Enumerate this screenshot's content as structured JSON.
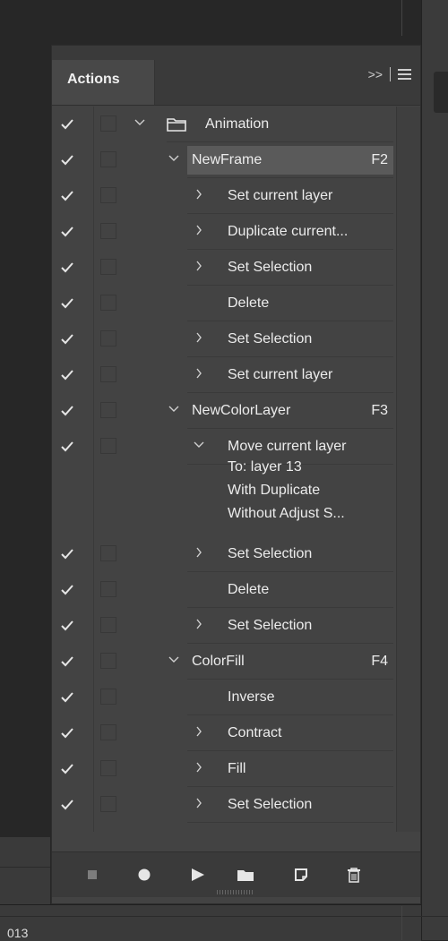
{
  "panel": {
    "tab_label": "Actions",
    "header_controls": {
      "expand_label": ">>"
    }
  },
  "actions": [
    {
      "id": "animation",
      "label": "Animation",
      "level": 0,
      "twirl": "open",
      "type": "set",
      "checked": true,
      "shortcut": ""
    },
    {
      "id": "newframe",
      "label": "NewFrame",
      "level": 1,
      "twirl": "open",
      "type": "action",
      "checked": true,
      "shortcut": "F2",
      "selected": true
    },
    {
      "id": "nf-set-current-layer-1",
      "label": "Set current layer",
      "level": 2,
      "twirl": "closed",
      "checked": true
    },
    {
      "id": "nf-duplicate-current",
      "label": "Duplicate current...",
      "level": 2,
      "twirl": "closed",
      "checked": true
    },
    {
      "id": "nf-set-selection-1",
      "label": "Set Selection",
      "level": 2,
      "twirl": "closed",
      "checked": true
    },
    {
      "id": "nf-delete",
      "label": "Delete",
      "level": 2,
      "twirl": "none",
      "checked": true
    },
    {
      "id": "nf-set-selection-2",
      "label": "Set Selection",
      "level": 2,
      "twirl": "closed",
      "checked": true
    },
    {
      "id": "nf-set-current-layer-2",
      "label": "Set current layer",
      "level": 2,
      "twirl": "closed",
      "checked": true
    },
    {
      "id": "newcolorlayer",
      "label": "NewColorLayer",
      "level": 1,
      "twirl": "open",
      "type": "action",
      "checked": true,
      "shortcut": "F3"
    },
    {
      "id": "ncl-move-current-layer",
      "label": "Move current layer",
      "level": 2,
      "twirl": "open",
      "checked": true,
      "details": [
        "To: layer 13",
        "With Duplicate",
        "Without Adjust S..."
      ]
    },
    {
      "id": "ncl-set-selection-1",
      "label": "Set Selection",
      "level": 2,
      "twirl": "closed",
      "checked": true
    },
    {
      "id": "ncl-delete",
      "label": "Delete",
      "level": 2,
      "twirl": "none",
      "checked": true
    },
    {
      "id": "ncl-set-selection-2",
      "label": "Set Selection",
      "level": 2,
      "twirl": "closed",
      "checked": true
    },
    {
      "id": "colorfill",
      "label": "ColorFill",
      "level": 1,
      "twirl": "open",
      "type": "action",
      "checked": true,
      "shortcut": "F4"
    },
    {
      "id": "cf-inverse",
      "label": "Inverse",
      "level": 2,
      "twirl": "none",
      "checked": true
    },
    {
      "id": "cf-contract",
      "label": "Contract",
      "level": 2,
      "twirl": "closed",
      "checked": true
    },
    {
      "id": "cf-fill",
      "label": "Fill",
      "level": 2,
      "twirl": "closed",
      "checked": true
    },
    {
      "id": "cf-set-selection",
      "label": "Set Selection",
      "level": 2,
      "twirl": "closed",
      "checked": true
    }
  ],
  "footer_buttons": [
    {
      "name": "stop-icon",
      "title": "Stop"
    },
    {
      "name": "record-icon",
      "title": "Record"
    },
    {
      "name": "play-icon",
      "title": "Play"
    },
    {
      "name": "new-set-folder-icon",
      "title": "New Set"
    },
    {
      "name": "new-action-icon",
      "title": "New Action"
    },
    {
      "name": "trash-icon",
      "title": "Delete"
    }
  ],
  "background": {
    "bottom_text": "013"
  }
}
